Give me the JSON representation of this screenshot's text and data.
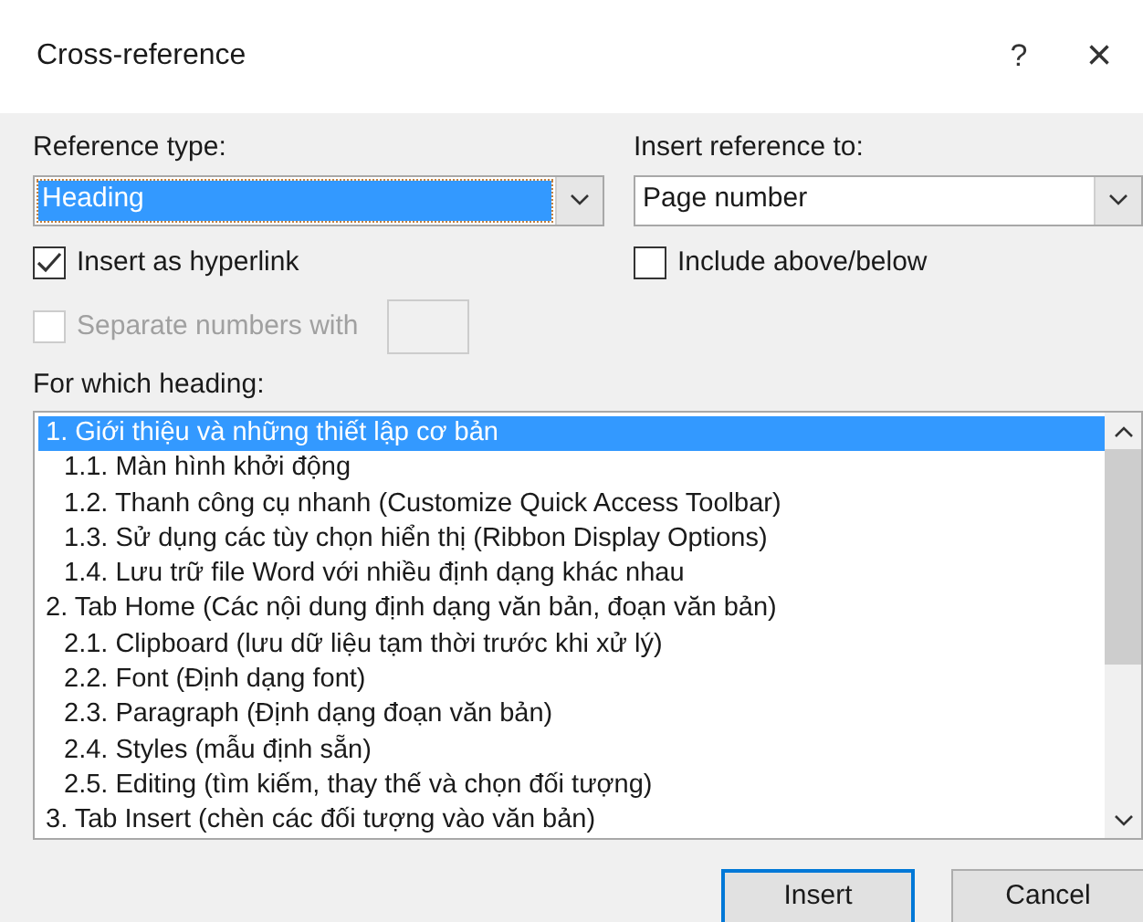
{
  "window": {
    "title": "Cross-reference",
    "help": "?",
    "close": "×"
  },
  "reference_type": {
    "label": "Reference type:",
    "value": "Heading",
    "focused": true
  },
  "insert_reference_to": {
    "label": "Insert reference to:",
    "value": "Page number"
  },
  "insert_as_hyperlink": {
    "label": "Insert as hyperlink",
    "checked": true,
    "disabled": false
  },
  "include_above_below": {
    "label": "Include above/below",
    "checked": false,
    "disabled": false
  },
  "separate_numbers": {
    "label": "Separate numbers with",
    "checked": false,
    "disabled": true
  },
  "headings": {
    "label": "For which heading:",
    "items": [
      {
        "text": "1. Giới thiệu và những thiết lập cơ bản",
        "selected": true,
        "children": [
          {
            "text": "1.1. Màn hình khởi động",
            "selected": false
          },
          {
            "text": "1.2. Thanh công cụ nhanh (Customize Quick Access Toolbar)",
            "selected": false
          },
          {
            "text": "1.3. Sử dụng các tùy chọn hiển thị (Ribbon Display Options)",
            "selected": false
          },
          {
            "text": "1.4. Lưu trữ file Word với nhiều định dạng khác nhau",
            "selected": false
          }
        ]
      },
      {
        "text": "2. Tab Home (Các nội dung định dạng văn bản, đoạn văn bản)",
        "selected": false,
        "children": [
          {
            "text": "2.1. Clipboard (lưu dữ liệu tạm thời trước khi xử lý)",
            "selected": false
          },
          {
            "text": "2.2. Font (Định dạng font)",
            "selected": false
          },
          {
            "text": "2.3. Paragraph (Định dạng đoạn văn bản)",
            "selected": false
          },
          {
            "text": "2.4. Styles (mẫu định sẵn)",
            "selected": false
          },
          {
            "text": "2.5. Editing (tìm kiếm, thay thế và chọn đối tượng)",
            "selected": false
          }
        ]
      },
      {
        "text": "3. Tab Insert (chèn các đối tượng vào văn bản)",
        "selected": false
      }
    ]
  },
  "buttons": [
    {
      "label": "Insert",
      "default": true
    },
    {
      "label": "Cancel",
      "default": false
    }
  ]
}
